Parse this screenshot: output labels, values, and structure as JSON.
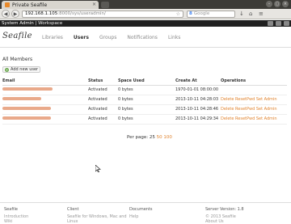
{
  "browser": {
    "tab_title": "Private Seafile",
    "tab_close": "×",
    "url_host": "192.168.1.105",
    "url_path": ":8000/sys/useradmin/",
    "search_placeholder": "Google",
    "win_min": "–",
    "win_max": "▢",
    "win_close": "×"
  },
  "topbar": {
    "system_admin": "System Admin",
    "separator": " | ",
    "workspace": "Workspace"
  },
  "header": {
    "logo": "Seafile",
    "nav": [
      "Libraries",
      "Users",
      "Groups",
      "Notifications",
      "Links"
    ]
  },
  "main": {
    "section_title": "All Members",
    "add_user": "Add new user",
    "columns": [
      "Email",
      "Status",
      "Space Used",
      "Create At",
      "Operations"
    ],
    "rows": [
      {
        "status": "Activated",
        "space": "0 bytes",
        "created": "1970-01-01 08:00:00",
        "ops": ""
      },
      {
        "status": "Activated",
        "space": "0 bytes",
        "created": "2013-10-11 04:28:03",
        "ops": "Delete ResetPwd Set Admin"
      },
      {
        "status": "Activated",
        "space": "0 bytes",
        "created": "2013-10-11 04:28:46",
        "ops": "Delete ResetPwd Set Admin"
      },
      {
        "status": "Activated",
        "space": "0 bytes",
        "created": "2013-10-11 04:29:34",
        "ops": "Delete ResetPwd Set Admin"
      }
    ],
    "pager_label": "Per page:",
    "pager_current": "25",
    "pager_opt1": "50",
    "pager_opt2": "100"
  },
  "footer": {
    "col1_head": "Seafile",
    "col1_links": [
      "Introduction",
      "Wiki"
    ],
    "col2_head": "Client",
    "col2_links": [
      "Seafile for Windows, Mac and",
      "Linux"
    ],
    "col3_head": "Documents",
    "col3_links": [
      "Help"
    ],
    "col4_head": "Server Version: 1.8",
    "col4_links": [
      "© 2013 Seafile",
      "About Us"
    ]
  }
}
